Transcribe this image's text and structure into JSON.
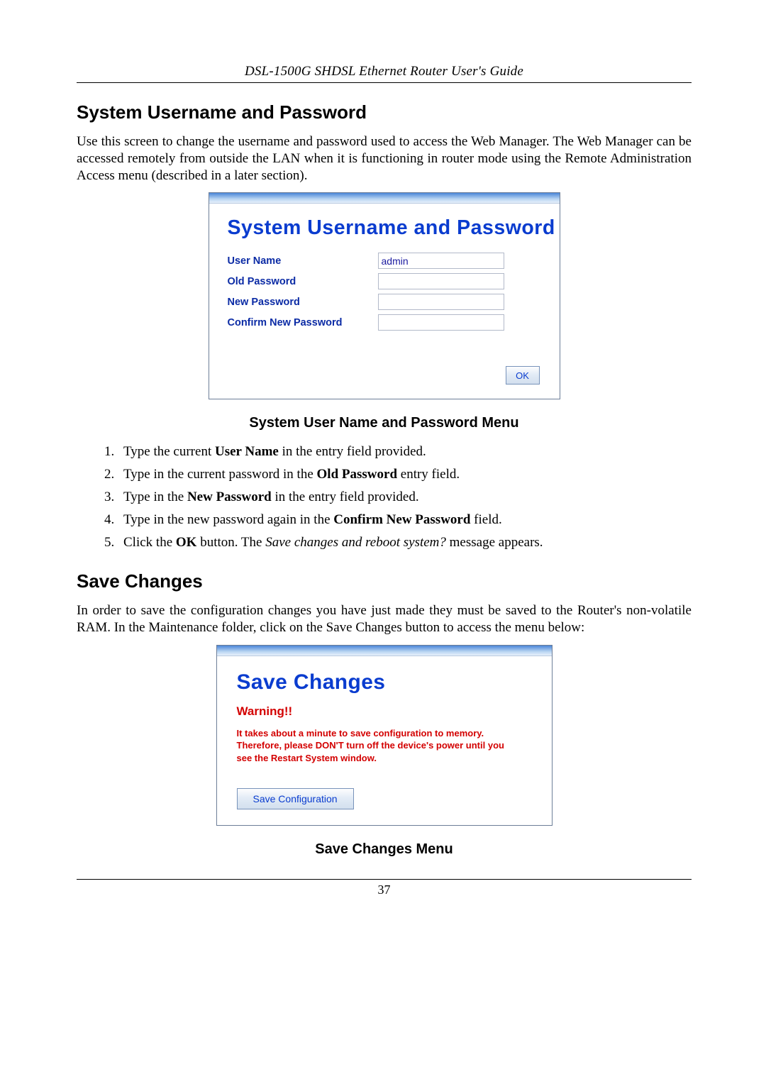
{
  "header": {
    "title": "DSL-1500G SHDSL Ethernet Router User's Guide"
  },
  "section1": {
    "heading": "System Username and Password",
    "intro": "Use this screen to change the username and password used to access the Web Manager. The Web Manager can be accessed remotely from outside the LAN when it is functioning in router mode using the Remote Administration Access menu (described in a later section).",
    "panel": {
      "title": "System Username and Password",
      "labels": {
        "user": "User Name",
        "old": "Old Password",
        "new": "New Password",
        "confirm": "Confirm New Password"
      },
      "values": {
        "user": "admin",
        "old": "",
        "new": "",
        "confirm": ""
      },
      "ok": "OK"
    },
    "caption": "System User Name and Password Menu",
    "steps": {
      "s1a": "Type the current ",
      "s1b": "User Name",
      "s1c": " in the entry field provided.",
      "s2a": "Type in the current password in the ",
      "s2b": "Old Password",
      "s2c": " entry field.",
      "s3a": "Type in the ",
      "s3b": "New Password",
      "s3c": " in the entry field provided.",
      "s4a": "Type in the new password again in the ",
      "s4b": "Confirm New Password",
      "s4c": " field.",
      "s5a": "Click the ",
      "s5b": "OK",
      "s5c": " button. The ",
      "s5d": "Save changes and reboot system?",
      "s5e": " message appears."
    }
  },
  "section2": {
    "heading": "Save Changes",
    "intro": "In order to save the configuration changes you have just made they must be saved to the Router's non-volatile RAM. In the Maintenance folder, click on the Save Changes button to access the menu below:",
    "panel": {
      "title": "Save Changes",
      "warning_head": "Warning!!",
      "warning_body": "It takes about a minute to save configuration to memory. Therefore, please DON'T turn off the device's power until you see the Restart System window.",
      "button": "Save Configuration"
    },
    "caption": "Save Changes Menu"
  },
  "footer": {
    "page": "37"
  }
}
